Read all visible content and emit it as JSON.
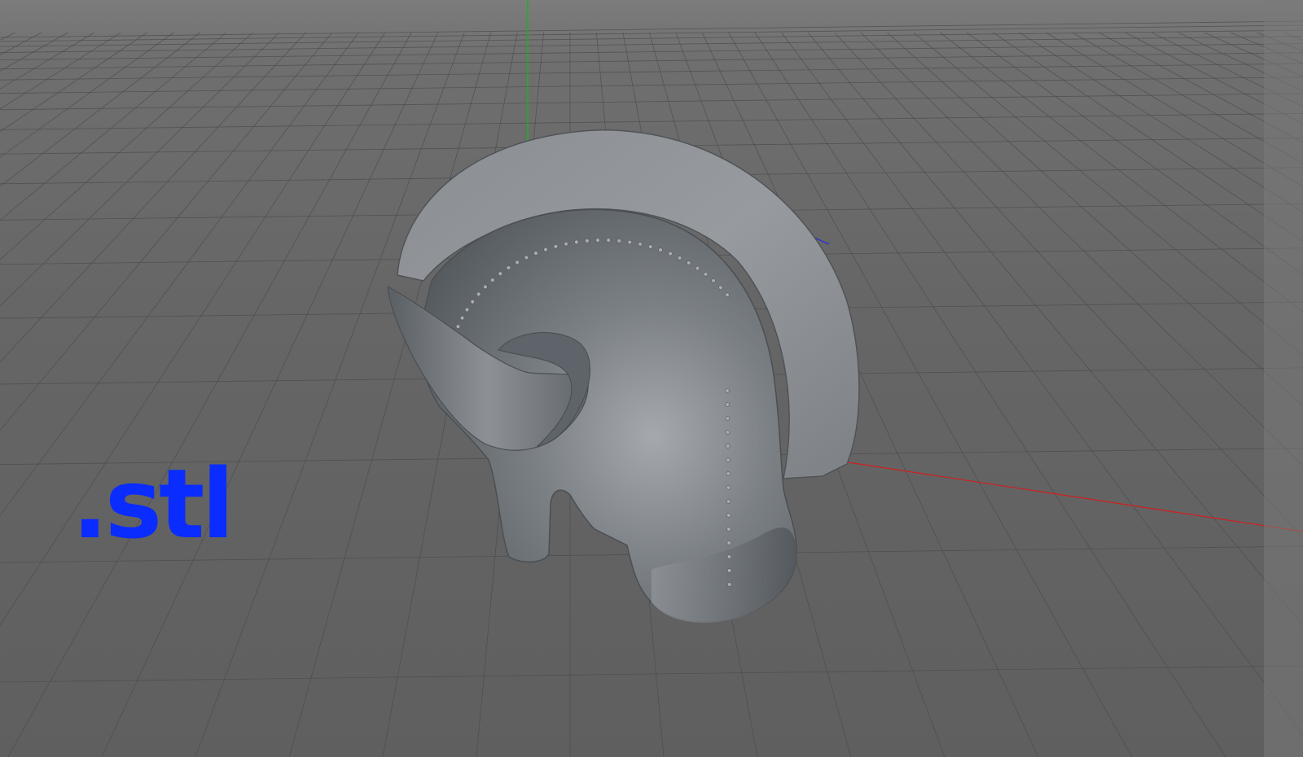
{
  "viewport": {
    "file_format_label": ".stl",
    "colors": {
      "background": "#666666",
      "grid_line": "#4a4a4a",
      "x_axis": "#d21e1e",
      "y_axis": "#18b418",
      "z_axis": "#3030d0",
      "model_shell": "#6f7479",
      "model_crest": "#888c90",
      "label": "#0a2cff"
    },
    "model": {
      "name": "helmet-with-crest-and-horn",
      "shading": "gouraud-gray"
    }
  }
}
